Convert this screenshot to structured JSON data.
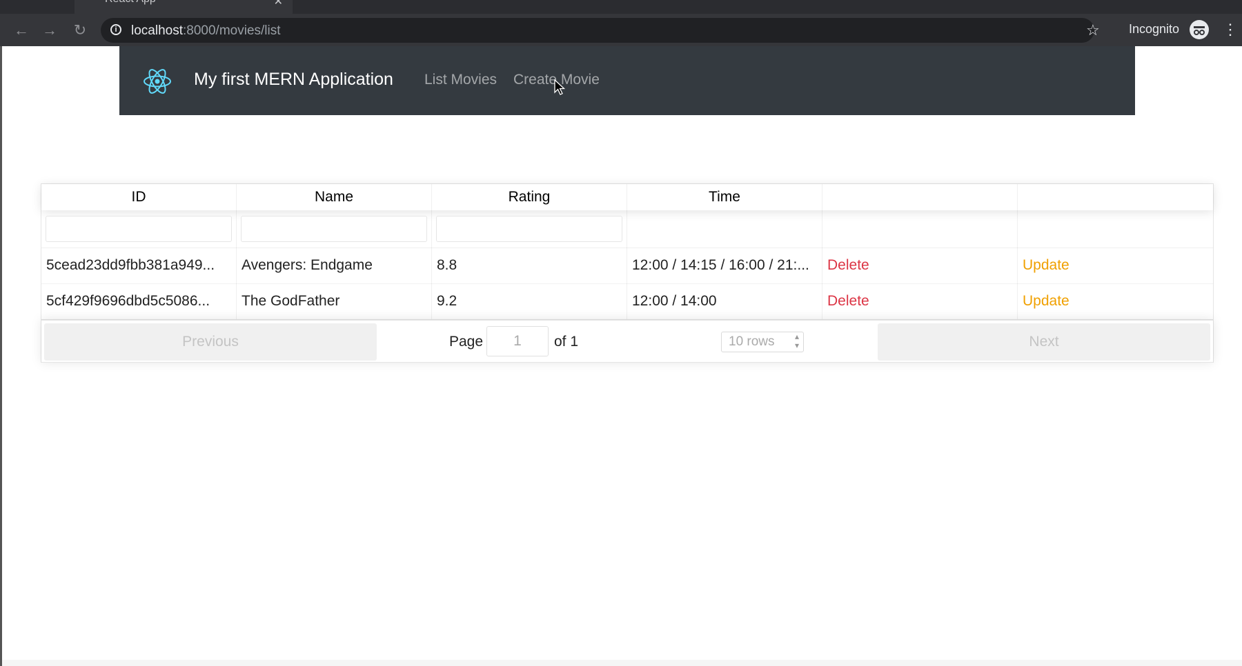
{
  "browser": {
    "tab_title": "React App",
    "url_host": "localhost",
    "url_path": ":8000/movies/list",
    "incognito_label": "Incognito"
  },
  "navbar": {
    "brand": "My first MERN Application",
    "links": [
      "List Movies",
      "Create Movie"
    ]
  },
  "table": {
    "headers": [
      "ID",
      "Name",
      "Rating",
      "Time",
      "",
      ""
    ],
    "rows": [
      {
        "id": "5cead23dd9fbb381a949...",
        "name": "Avengers: Endgame",
        "rating": "8.8",
        "time": "12:00 / 14:15 / 16:00 / 21:...",
        "delete": "Delete",
        "update": "Update"
      },
      {
        "id": "5cf429f9696dbd5c5086...",
        "name": "The GodFather",
        "rating": "9.2",
        "time": "12:00 / 14:00",
        "delete": "Delete",
        "update": "Update"
      }
    ]
  },
  "pagination": {
    "previous": "Previous",
    "page_label": "Page",
    "page_value": "1",
    "of_label": "of 1",
    "rows_option": "10 rows",
    "next": "Next"
  },
  "colors": {
    "navbar": "#343a40",
    "delete": "#dc3545",
    "update": "#f0a000",
    "react_logo": "#61dafb"
  }
}
